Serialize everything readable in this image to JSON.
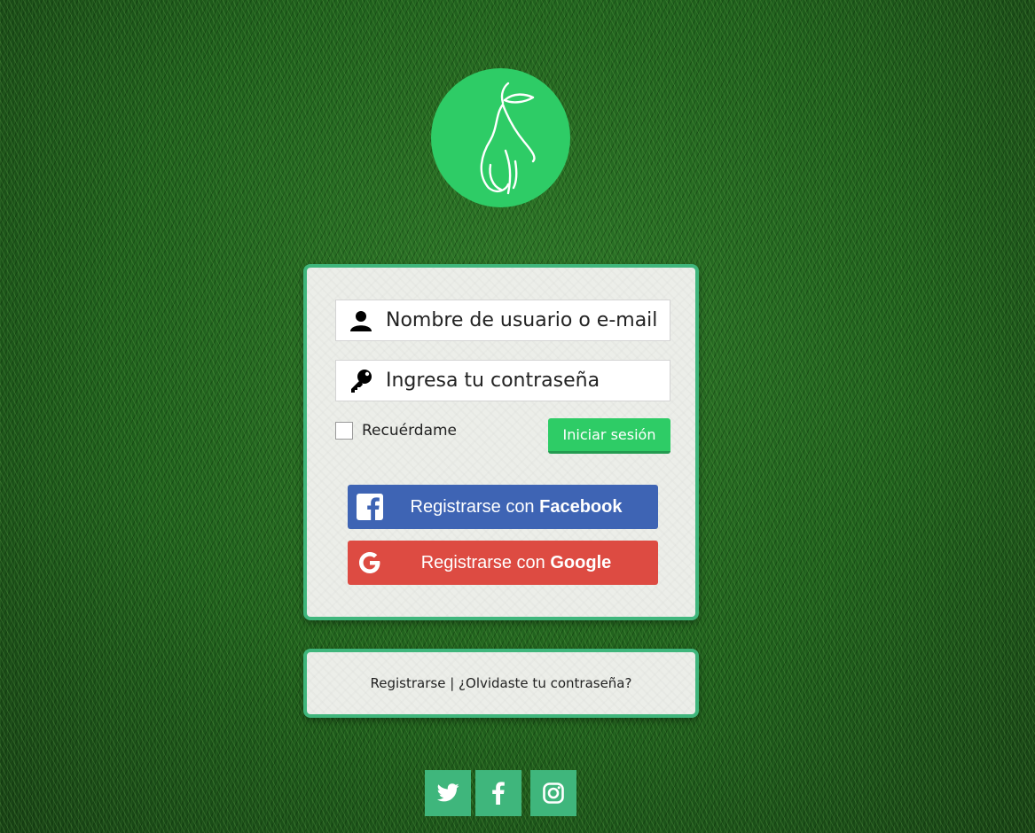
{
  "logo": {
    "icon": "pear-icon",
    "color": "#2ecc66"
  },
  "form": {
    "username_placeholder": "Nombre de usuario o e-mail",
    "password_placeholder": "Ingresa tu contraseña",
    "remember_label": "Recuérdame",
    "login_label": "Iniciar sesión"
  },
  "social_login": {
    "facebook": {
      "prefix": "Registrarse con ",
      "brand": "Facebook",
      "color": "#3e64b4"
    },
    "google": {
      "prefix": "Registrarse con ",
      "brand": "Google",
      "color": "#dd4b42"
    }
  },
  "links": {
    "register": "Registrarse",
    "separator": " | ",
    "forgot": "¿Olvidaste tu contraseña?"
  },
  "footer_social": [
    {
      "icon": "twitter-icon"
    },
    {
      "icon": "facebook-icon"
    },
    {
      "icon": "instagram-icon"
    }
  ],
  "colors": {
    "accent": "#2ecc66",
    "card_border": "#3fb67c"
  }
}
